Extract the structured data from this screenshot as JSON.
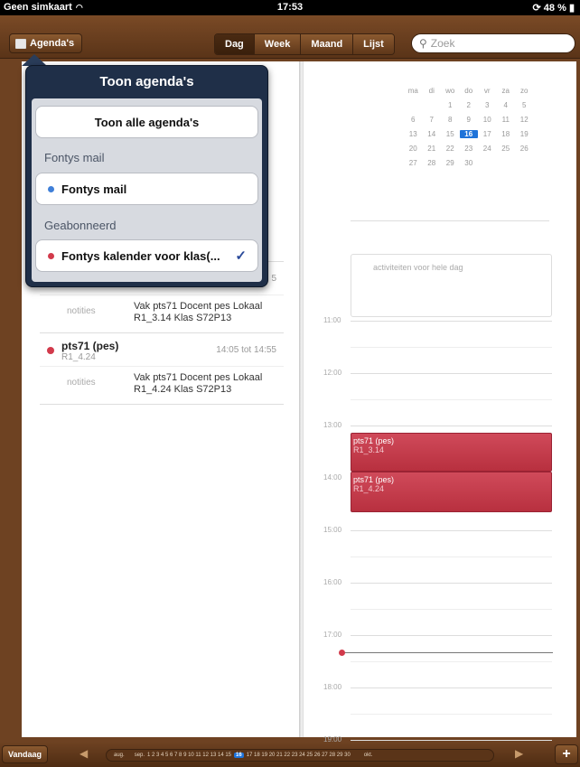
{
  "status_bar": {
    "carrier": "Geen simkaart",
    "time": "17:53",
    "battery": "48 %"
  },
  "toolbar": {
    "agendas_label": "Agenda's",
    "segments": [
      "Dag",
      "Week",
      "Maand",
      "Lijst"
    ],
    "search_placeholder": "Zoek"
  },
  "popover": {
    "title": "Toon agenda's",
    "show_all": "Toon alle agenda's",
    "sections": [
      {
        "header": "Fontys mail",
        "item": "Fontys mail",
        "color": "#3f7fd8"
      },
      {
        "header": "Geabonneerd",
        "item": "Fontys kalender voor klas(...",
        "color": "#d23a4b",
        "checked": "✓"
      }
    ]
  },
  "left_events": [
    {
      "title": "pts71 (pes)",
      "location": "R1_3.14",
      "time": "5",
      "notes_label": "notities",
      "notes": "Vak pts71 Docent pes Lokaal R1_3.14 Klas S72P13"
    },
    {
      "title": "pts71 (pes)",
      "location": "R1_4.24",
      "time": "14:05 tot 14:55",
      "notes_label": "notities",
      "notes": "Vak pts71 Docent pes Lokaal R1_4.24 Klas S72P13"
    }
  ],
  "mini_calendar": {
    "weekdays": [
      "ma",
      "di",
      "wo",
      "do",
      "vr",
      "za",
      "zo"
    ],
    "weeks": [
      [
        "",
        "",
        "1",
        "2",
        "3",
        "4",
        "5"
      ],
      [
        "6",
        "7",
        "8",
        "9",
        "10",
        "11",
        "12"
      ],
      [
        "13",
        "14",
        "15",
        "16",
        "17",
        "18",
        "19"
      ],
      [
        "20",
        "21",
        "22",
        "23",
        "24",
        "25",
        "26"
      ],
      [
        "27",
        "28",
        "29",
        "30",
        "",
        "",
        ""
      ]
    ],
    "selected": "16"
  },
  "day_view": {
    "all_day_label": "activiteiten voor hele dag",
    "hours": [
      "11:00",
      "12:00",
      "13:00",
      "14:00",
      "15:00",
      "16:00",
      "17:00",
      "18:00",
      "19:00"
    ],
    "events": [
      {
        "title": "pts71 (pes)",
        "location": "R1_3.14"
      },
      {
        "title": "pts71 (pes)",
        "location": "R1_4.24"
      }
    ]
  },
  "bottom_bar": {
    "today_label": "Vandaag",
    "timeline_start": "aug.",
    "timeline_month": "sep.",
    "days_before": "1 2 3 4 5 6 7 8 9 10 11 12 13 14 15",
    "selected_day": "16",
    "days_after": "17 18 19 20 21 22 23 24 25 26 27 28 29 30",
    "timeline_end": "okt.",
    "add_label": "+"
  }
}
